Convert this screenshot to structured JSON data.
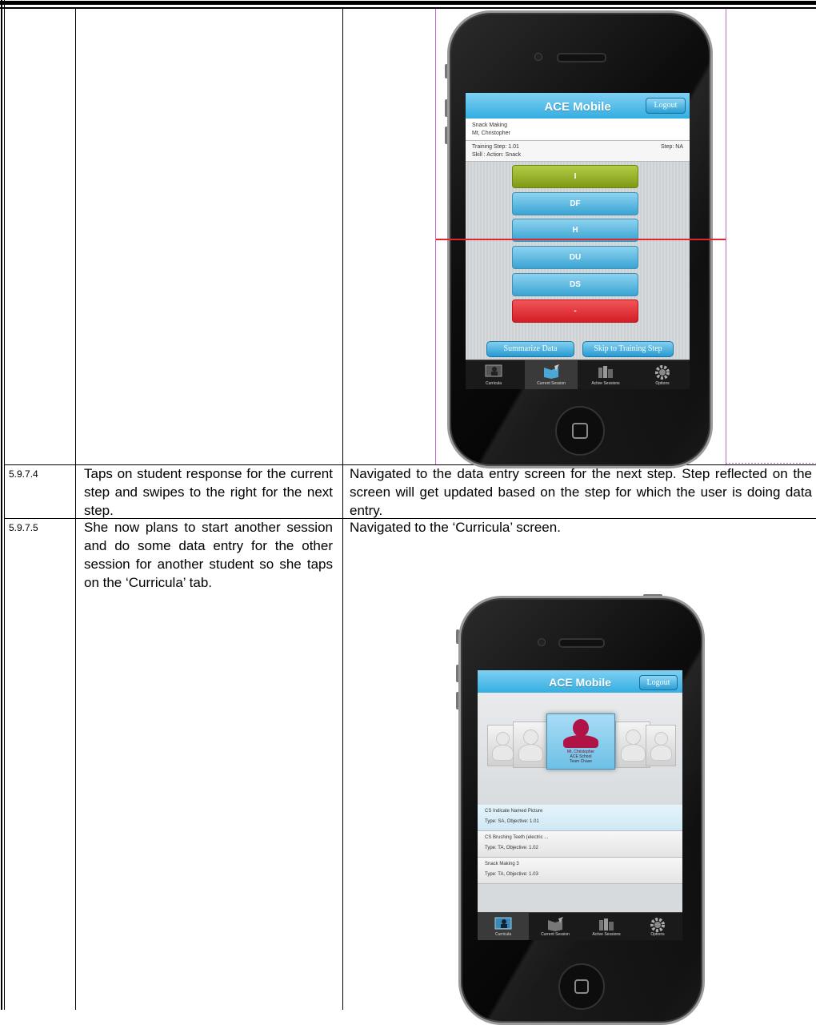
{
  "rows": [
    {
      "id": "5.9.7.4",
      "action": "Taps on student response for the current step and swipes to the right for the next step.",
      "result": "Navigated to the data entry screen for the next step. Step reflected on the screen will get updated based on the step for which the user is doing data entry."
    },
    {
      "id": "5.9.7.5",
      "action": "She now plans to start another session and do some data entry for the other session for another student so she taps on the ‘Curricula’ tab.",
      "result": "Navigated to the ‘Curricula’ screen."
    }
  ],
  "phone1": {
    "app_title": "ACE Mobile",
    "logout": "Logout",
    "task": "Snack Making",
    "student": "Mt, Christopher",
    "training_step": "Training Step: 1.01",
    "step": "Step: NA",
    "skill": "Skill : Action: Snack",
    "responses": [
      "I",
      "DF",
      "H",
      "DU",
      "DS",
      "-"
    ],
    "summarize": "Summarize Data",
    "skip": "Skip to Training Step",
    "tabs": [
      "Curricula",
      "Current Session",
      "Active Sessions",
      "Options"
    ],
    "active_tab": "Current Session"
  },
  "phone2": {
    "app_title": "ACE Mobile",
    "logout": "Logout",
    "student_name": "Mt, Christopher",
    "school": "ACE School",
    "team": "Team Chase",
    "items": [
      {
        "title": "CS Indicate Named Picture",
        "sub": "Type: SA, Objective: 1.01"
      },
      {
        "title": "CS Brushing Teeth (electric ...",
        "sub": "Type: TA, Objective: 1.02"
      },
      {
        "title": "Snack Making 3",
        "sub": "Type: TA, Objective: 1.03"
      }
    ],
    "tabs": [
      "Curricula",
      "Current Session",
      "Active Sessions",
      "Options"
    ],
    "active_tab": "Curricula"
  },
  "colors": {
    "header_blue": "#33aee2",
    "green_button": "#7e9a14",
    "red_button": "#d51d24",
    "guide_pink": "#c36ac9",
    "guide_red": "#e0262b"
  }
}
